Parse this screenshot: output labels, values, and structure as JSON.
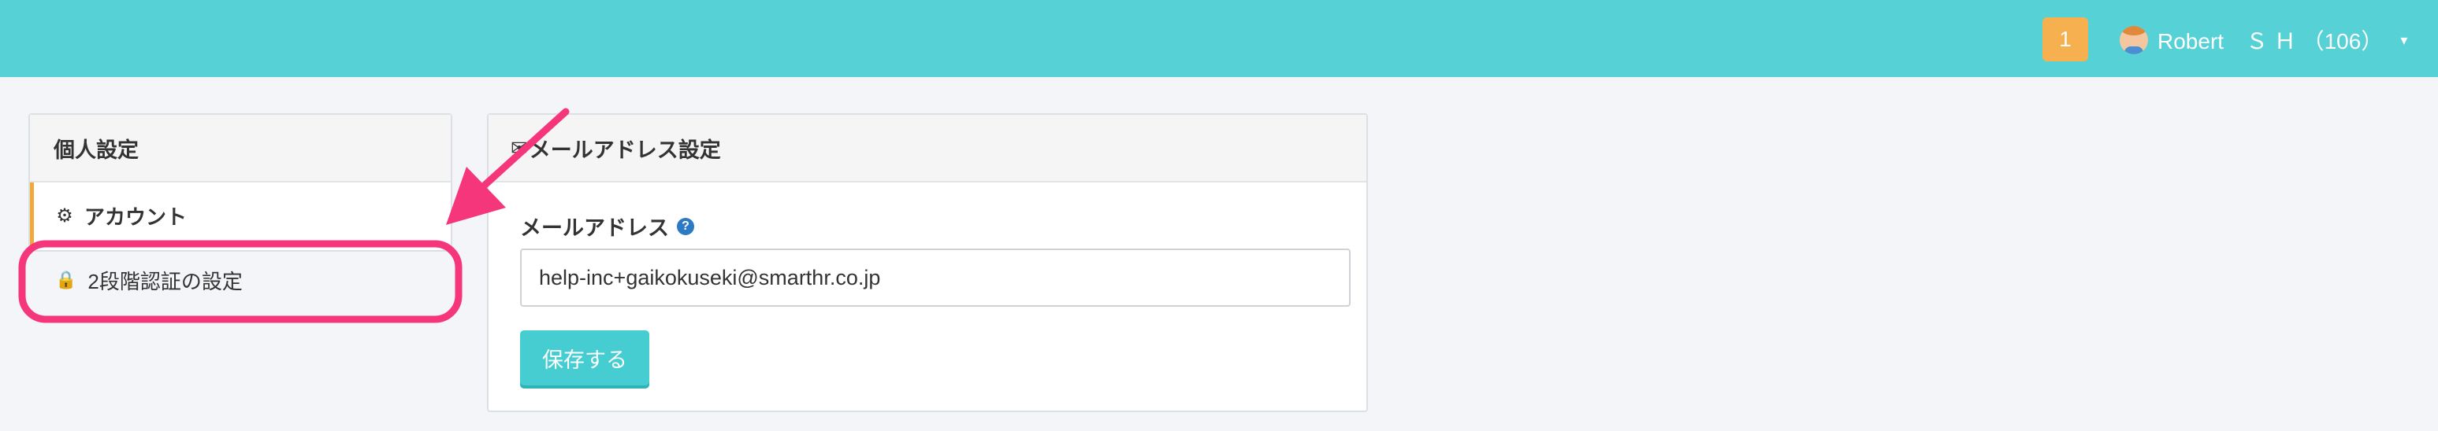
{
  "header": {
    "notification_count": "1",
    "user_name": "Robert　Ｓ Ｈ （106）",
    "caret": "▾"
  },
  "sidebar": {
    "title": "個人設定",
    "items": [
      {
        "icon": "gear-icon",
        "glyph": "⚙",
        "label": "アカウント"
      },
      {
        "icon": "lock-icon",
        "glyph": "🔒",
        "label": "2段階認証の設定"
      }
    ]
  },
  "email_panel": {
    "title": "メールアドレス設定",
    "title_icon": "✉",
    "field_label": "メールアドレス",
    "help_glyph": "?",
    "email_value": "help-inc+gaikokuseki@smarthr.co.jp",
    "save_label": "保存する"
  },
  "colors": {
    "header_bg": "#56d1d6",
    "badge_bg": "#f7b04f",
    "active_accent": "#f2a93b",
    "save_button": "#45cdd1",
    "annotation": "#f5367a"
  }
}
